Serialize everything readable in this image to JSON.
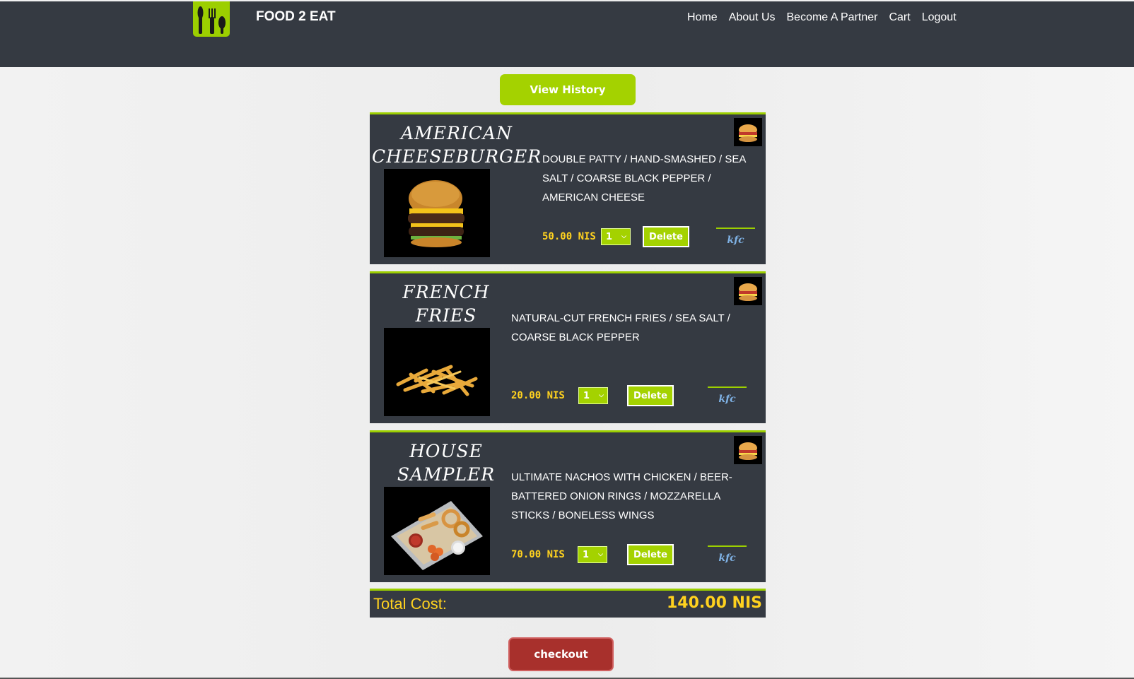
{
  "header": {
    "brand": "FOOD 2 EAT",
    "nav": [
      "Home",
      "About Us",
      "Become A Partner",
      "Cart",
      "Logout"
    ]
  },
  "view_history_label": "View History",
  "cart_items": [
    {
      "title": "AMERICAN CHEESEBURGER",
      "description": "DOUBLE PATTY / HAND-SMASHED / SEA SALT / COARSE BLACK PEPPER / AMERICAN CHEESE",
      "price": "50.00 NIS",
      "quantity": "1",
      "delete_label": "Delete",
      "restaurant": "kfc"
    },
    {
      "title": "FRENCH FRIES",
      "description": "NATURAL-CUT FRENCH FRIES / SEA SALT / COARSE BLACK PEPPER",
      "price": "20.00 NIS",
      "quantity": "1",
      "delete_label": "Delete",
      "restaurant": "kfc"
    },
    {
      "title": "HOUSE SAMPLER",
      "description": "ULTIMATE NACHOS WITH CHICKEN / BEER-BATTERED ONION RINGS / MOZZARELLA STICKS / BONELESS WINGS",
      "price": "70.00 NIS",
      "quantity": "1",
      "delete_label": "Delete",
      "restaurant": "kfc"
    }
  ],
  "total": {
    "label": "Total Cost:",
    "value": "140.00 NIS"
  },
  "checkout_label": "checkout",
  "colors": {
    "accent": "#9ccf00",
    "panel": "#353a42",
    "price": "#ffd21f",
    "checkout": "#a8302c"
  }
}
